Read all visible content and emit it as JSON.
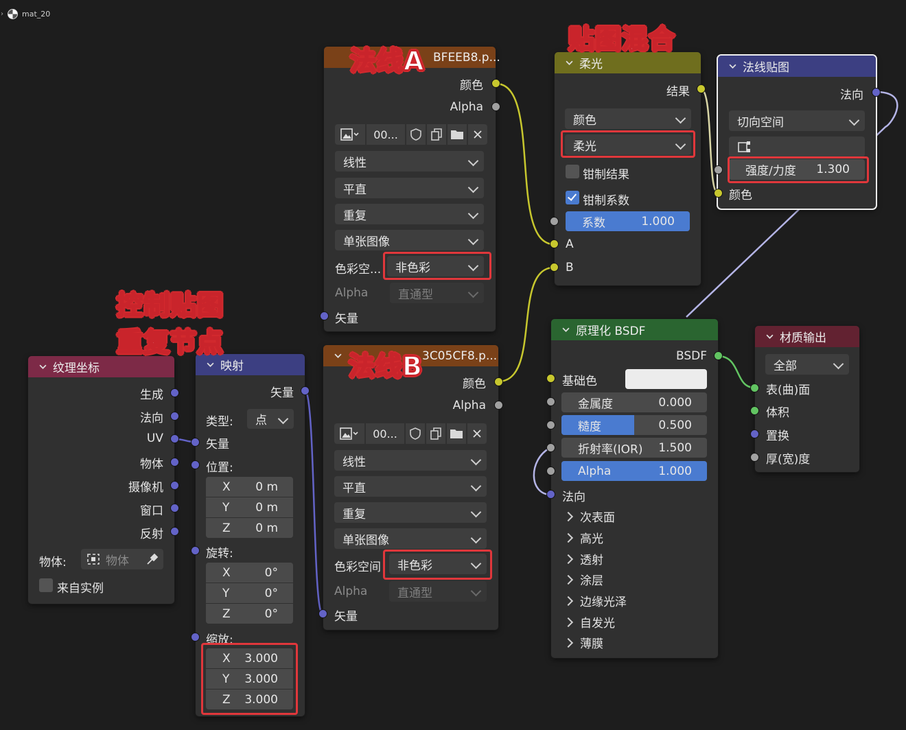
{
  "breadcrumb": {
    "material": "mat_20"
  },
  "annotations": {
    "normal_a": "法线A",
    "normal_b": "法线B",
    "texture_mix": "贴图混合",
    "mapping_note_line1": "控制贴图",
    "mapping_note_line2": "重复节点"
  },
  "image_a": {
    "title": "法线A",
    "title_suffix": "BFEEB8.p...",
    "outputs": [
      "颜色",
      "Alpha"
    ],
    "image_name": "00...",
    "interpolation": "线性",
    "projection": "平直",
    "extension": "重复",
    "source": "单张图像",
    "colorspace_label": "色彩空...",
    "colorspace_value": "非色彩",
    "alpha_label": "Alpha",
    "alpha_value": "直通型",
    "input_vector": "矢量"
  },
  "image_b": {
    "title": "法线B",
    "title_suffix": "3C05CF8.p...",
    "outputs": [
      "颜色",
      "Alpha"
    ],
    "image_name": "00...",
    "interpolation": "线性",
    "projection": "平直",
    "extension": "重复",
    "source": "单张图像",
    "colorspace_label": "色彩空间",
    "colorspace_value": "非色彩",
    "alpha_label": "Alpha",
    "alpha_value": "直通型",
    "input_vector": "矢量"
  },
  "mix": {
    "title": "柔光",
    "output": "结果",
    "data_type": "颜色",
    "blend_mode": "柔光",
    "clamp_result": "钳制结果",
    "clamp_result_checked": false,
    "clamp_factor": "钳制系数",
    "clamp_factor_checked": true,
    "factor_label": "系数",
    "factor_value": "1.000",
    "factor_fill": 1.0,
    "input_a": "A",
    "input_b": "B"
  },
  "normal_map": {
    "title": "法线贴图",
    "output": "法向",
    "space": "切向空间",
    "strength_label": "强度/力度",
    "strength_value": "1.300",
    "input_color": "颜色"
  },
  "tex_coord": {
    "title": "纹理坐标",
    "outputs": [
      "生成",
      "法向",
      "UV",
      "物体",
      "摄像机",
      "窗口",
      "反射"
    ],
    "object_label": "物体:",
    "object_placeholder": "物体",
    "from_instancer": "来自实例"
  },
  "mapping": {
    "title": "映射",
    "output": "矢量",
    "type_label": "类型:",
    "type_value": "点",
    "input_vector": "矢量",
    "location_label": "位置:",
    "location": [
      {
        "axis": "X",
        "value": "0 m"
      },
      {
        "axis": "Y",
        "value": "0 m"
      },
      {
        "axis": "Z",
        "value": "0 m"
      }
    ],
    "rotation_label": "旋转:",
    "rotation": [
      {
        "axis": "X",
        "value": "0°"
      },
      {
        "axis": "Y",
        "value": "0°"
      },
      {
        "axis": "Z",
        "value": "0°"
      }
    ],
    "scale_label": "缩放:",
    "scale": [
      {
        "axis": "X",
        "value": "3.000"
      },
      {
        "axis": "Y",
        "value": "3.000"
      },
      {
        "axis": "Z",
        "value": "3.000"
      }
    ]
  },
  "bsdf": {
    "title": "原理化 BSDF",
    "output": "BSDF",
    "base_color": "基础色",
    "base_color_hex": "#ececec",
    "metallic_label": "金属度",
    "metallic_value": "0.000",
    "metallic_fill": 0.0,
    "roughness_label": "糙度",
    "roughness_value": "0.500",
    "roughness_fill": 0.5,
    "ior_label": "折射率(IOR)",
    "ior_value": "1.500",
    "ior_fill": 0.0,
    "alpha_label": "Alpha",
    "alpha_value": "1.000",
    "alpha_fill": 1.0,
    "normal": "法向",
    "panels": [
      "次表面",
      "高光",
      "透射",
      "涂层",
      "边缘光泽",
      "自发光",
      "薄膜"
    ]
  },
  "output": {
    "title": "材质输出",
    "target": "全部",
    "inputs": [
      "表(曲)面",
      "体积",
      "置换",
      "厚(宽)度"
    ]
  },
  "colors": {
    "image_header": "#7a4118",
    "mix_header": "#6f6e1e",
    "normal_header": "#3c3f82",
    "texcoord_header": "#7d2a47",
    "bsdf_header": "#2a6530",
    "output_header": "#622231",
    "socket_color": "#c7c72e",
    "socket_float": "#a1a1a1",
    "socket_vector": "#6363c7",
    "socket_shader": "#62c462",
    "highlight": "#e0373b",
    "slider_blue": "#4a7bd0"
  }
}
